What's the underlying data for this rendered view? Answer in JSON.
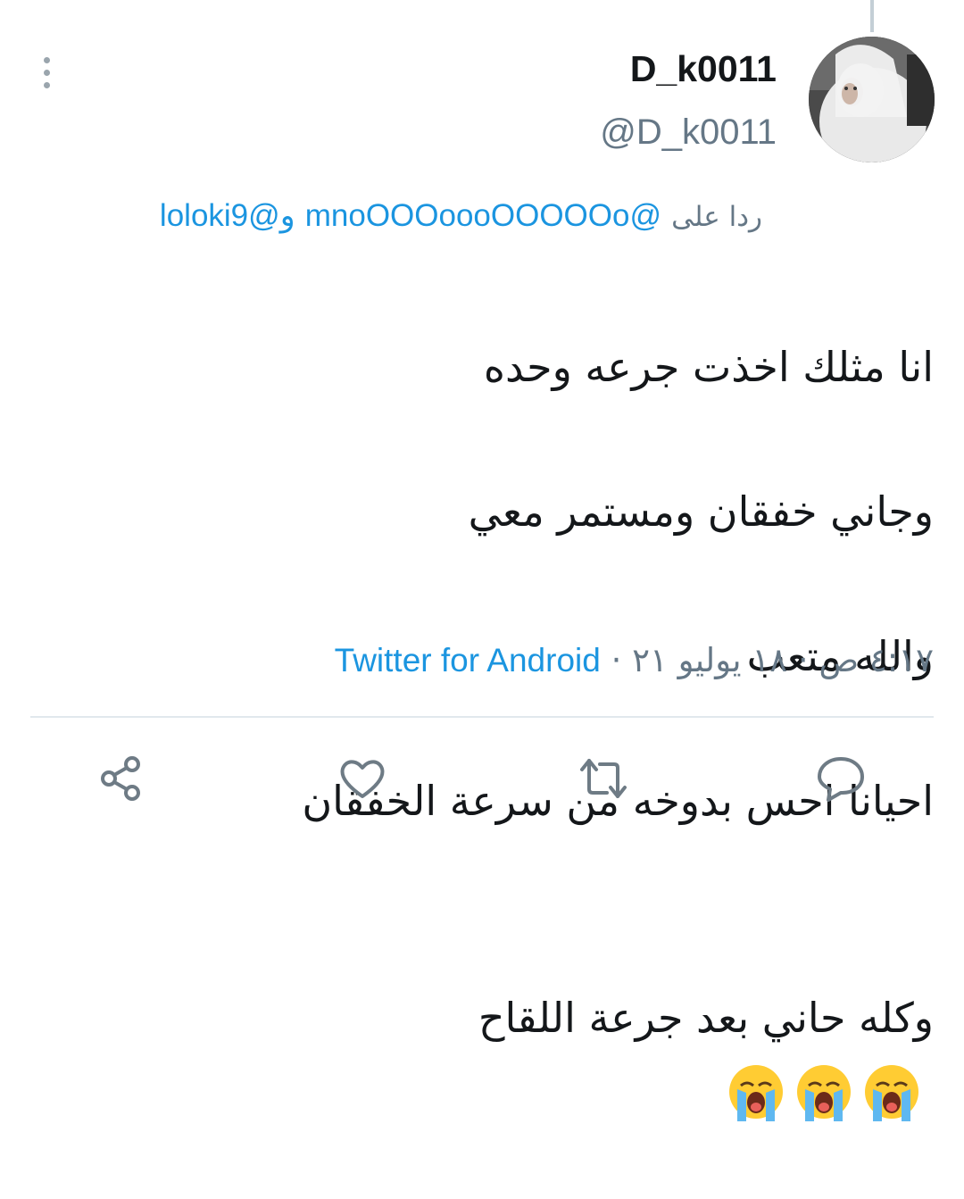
{
  "tweet": {
    "display_name": "D_k0011",
    "handle": "@D_k0011",
    "reply_prefix": "ردا على",
    "reply_users": [
      "@mnoOOOoooOOOOOo",
      "@loloki9"
    ],
    "reply_joiner": "و",
    "text_lines": [
      "انا مثلك اخذت جرعه وحده",
      "وجاني خفقان ومستمر معي",
      "والله متعب",
      "احيانا احس بدوخه من  سرعة  الخفقان",
      "وكله حاني بعد جرعة اللقاح"
    ],
    "emoji": [
      "loudly-crying-face",
      "loudly-crying-face",
      "loudly-crying-face"
    ],
    "timestamp": "٤:١٧ ص · ١٨ يوليو ٢١",
    "separator": "·",
    "source": "Twitter for Android"
  },
  "colors": {
    "link": "#1b95e0",
    "secondary_text": "#657786",
    "primary_text": "#14171a",
    "icon": "#6e7b85",
    "divider": "#e1e8ed"
  },
  "actions": [
    {
      "name": "reply",
      "icon": "speech-bubble-icon"
    },
    {
      "name": "retweet",
      "icon": "retweet-icon"
    },
    {
      "name": "like",
      "icon": "heart-icon"
    },
    {
      "name": "share",
      "icon": "share-nodes-icon"
    }
  ]
}
